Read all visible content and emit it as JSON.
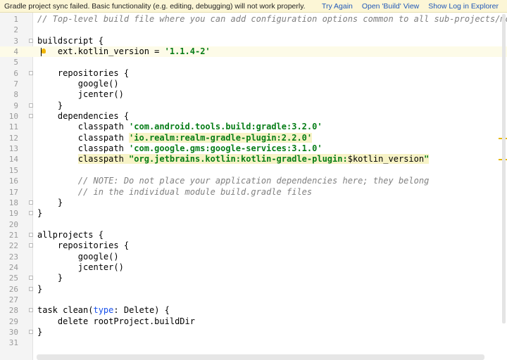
{
  "banner": {
    "message": "Gradle project sync failed. Basic functionality (e.g. editing, debugging) will not work properly.",
    "actions": [
      "Try Again",
      "Open 'Build' View",
      "Show Log in Explorer"
    ],
    "background_color": "#fcf6d6",
    "link_color": "#2058b8"
  },
  "editor": {
    "current_line": 4,
    "lines": [
      {
        "n": "1",
        "html": "<span class=\"cm\">// Top-level build file where you can add configuration options common to all sub-projects/modu</span>"
      },
      {
        "n": "2",
        "html": ""
      },
      {
        "n": "3",
        "html": "buildscript {"
      },
      {
        "n": "4",
        "html": "    ext.kotlin_version = <span class=\"str\">'1.1.4-2'</span>"
      },
      {
        "n": "5",
        "html": ""
      },
      {
        "n": "6",
        "html": "    repositories {"
      },
      {
        "n": "7",
        "html": "        google()"
      },
      {
        "n": "8",
        "html": "        jcenter()"
      },
      {
        "n": "9",
        "html": "    }"
      },
      {
        "n": "10",
        "html": "    dependencies {"
      },
      {
        "n": "11",
        "html": "        classpath <span class=\"str\">'com.android.tools.build:gradle:3.2.0'</span>"
      },
      {
        "n": "12",
        "html": "        classpath <span class=\"str hl\">'io.realm:realm-gradle-plugin:2.2.0'</span>"
      },
      {
        "n": "13",
        "html": "        classpath <span class=\"str\">'com.google.gms:google-services:3.1.0'</span>"
      },
      {
        "n": "14",
        "html": "        <span class=\"hl\">classpath <span class=\"str\">\"org.jetbrains.kotlin:kotlin-gradle-plugin:</span>$kotlin_version<span class=\"str\">\"</span></span>"
      },
      {
        "n": "15",
        "html": ""
      },
      {
        "n": "16",
        "html": "        <span class=\"cm\">// NOTE: Do not place your application dependencies here; they belong</span>"
      },
      {
        "n": "17",
        "html": "        <span class=\"cm\">// in the individual module build.gradle files</span>"
      },
      {
        "n": "18",
        "html": "    }"
      },
      {
        "n": "19",
        "html": "}"
      },
      {
        "n": "20",
        "html": ""
      },
      {
        "n": "21",
        "html": "allprojects {"
      },
      {
        "n": "22",
        "html": "    repositories {"
      },
      {
        "n": "23",
        "html": "        google()"
      },
      {
        "n": "24",
        "html": "        jcenter()"
      },
      {
        "n": "25",
        "html": "    }"
      },
      {
        "n": "26",
        "html": "}"
      },
      {
        "n": "27",
        "html": ""
      },
      {
        "n": "28",
        "html": "task clean(<span class=\"named\">type</span>: Delete) {"
      },
      {
        "n": "29",
        "html": "    delete rootProject.buildDir"
      },
      {
        "n": "30",
        "html": "}"
      },
      {
        "n": "31",
        "html": ""
      }
    ],
    "fold_lines": [
      3,
      6,
      9,
      10,
      18,
      19,
      21,
      22,
      25,
      26,
      28,
      30
    ],
    "warning_marker_lines": [
      12,
      14
    ],
    "string_color": "#067d17",
    "comment_color": "#808080"
  }
}
